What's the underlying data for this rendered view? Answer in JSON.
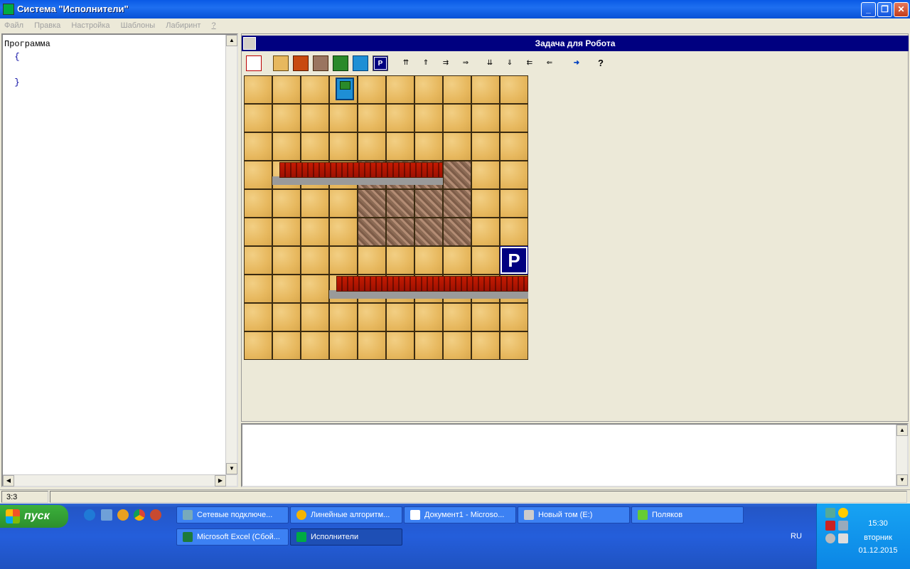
{
  "window": {
    "title": "Система \"Исполнители\"",
    "min": "_",
    "max": "❐",
    "close": "✕"
  },
  "menu": [
    "Файл",
    "Правка",
    "Настройка",
    "Шаблоны",
    "Лабиринт",
    "?"
  ],
  "editor": {
    "line1": "Программа",
    "line2": "  {",
    "line3": "",
    "line4": "  }"
  },
  "robot_panel": {
    "title": "Задача для Робота"
  },
  "toolbar": {
    "icons": [
      "new-field-icon",
      "sand-icon",
      "wall-icon",
      "paint-icon",
      "tree-icon",
      "robot-icon",
      "parking-icon",
      "up-rule-icon",
      "up-step-icon",
      "right-rule-icon",
      "right-step-icon",
      "down-rule-icon",
      "down-step-icon",
      "left-rule-icon",
      "left-step-icon",
      "exit-icon",
      "help-icon"
    ],
    "parking_label": "P",
    "help_label": "?"
  },
  "field": {
    "cols": 10,
    "rows": 10,
    "painted_cells": [
      [
        4,
        3
      ],
      [
        5,
        3
      ],
      [
        6,
        3
      ],
      [
        7,
        3
      ],
      [
        4,
        4
      ],
      [
        5,
        4
      ],
      [
        6,
        4
      ],
      [
        7,
        4
      ],
      [
        4,
        5
      ],
      [
        5,
        5
      ],
      [
        6,
        5
      ],
      [
        7,
        5
      ]
    ],
    "walls": [
      {
        "row": 3,
        "from_col": 1,
        "to_col": 7
      },
      {
        "row": 7,
        "from_col": 3,
        "to_col": 10
      }
    ],
    "robot": {
      "col": 3,
      "row": 0
    },
    "parking": {
      "col": 9,
      "row": 6,
      "label": "P"
    }
  },
  "status": {
    "position": "3:3"
  },
  "taskbar": {
    "start": "пуск",
    "tasks_row1": [
      "Сетевые подключе...",
      "Линейные алгоритм...",
      "Документ1 - Microso...",
      "Новый том (E:)",
      "Поляков"
    ],
    "tasks_row2": [
      "Microsoft Excel (Сбой...",
      "Исполнители"
    ],
    "lang": "RU",
    "clock": {
      "time": "15:30",
      "day": "вторник",
      "date": "01.12.2015"
    }
  }
}
